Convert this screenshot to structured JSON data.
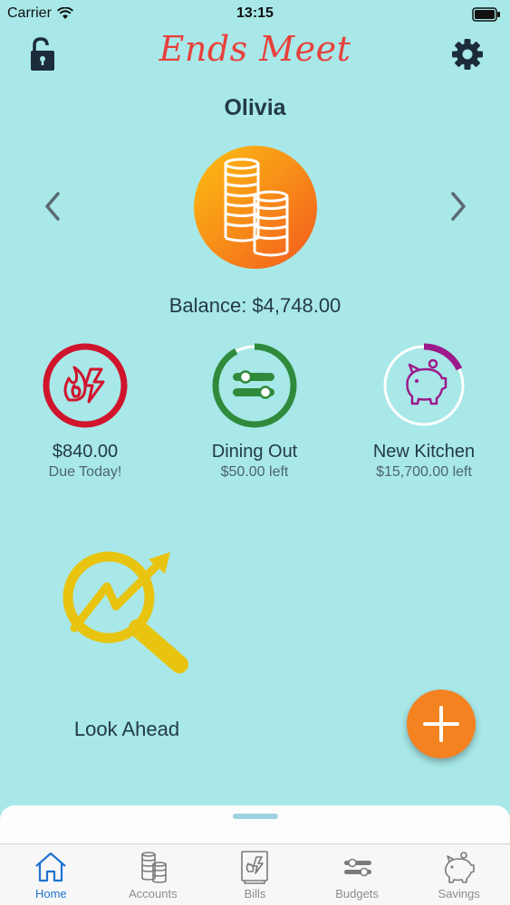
{
  "status": {
    "carrier": "Carrier",
    "time": "13:15"
  },
  "header": {
    "logo": "Ends Meet"
  },
  "account": {
    "name": "Olivia",
    "balance": "Balance: $4,748.00"
  },
  "tiles": [
    {
      "title": "$840.00",
      "subtitle": "Due Today!",
      "icon": "gas-electric-icon",
      "color": "#d0142c",
      "progress": 1.0
    },
    {
      "title": "Dining Out",
      "subtitle": "$50.00 left",
      "icon": "sliders-icon",
      "color": "#2f8a3c",
      "progress": 0.92
    },
    {
      "title": "New Kitchen",
      "subtitle": "$15,700.00 left",
      "icon": "piggy-bank-icon",
      "color": "#9c1a8c",
      "progress": 0.18
    }
  ],
  "look_ahead": {
    "label": "Look Ahead",
    "icon": "magnifier-trend-icon",
    "color": "#e8c410"
  },
  "tabs": [
    {
      "label": "Home",
      "icon": "home-icon",
      "active": true
    },
    {
      "label": "Accounts",
      "icon": "coins-icon",
      "active": false
    },
    {
      "label": "Bills",
      "icon": "bill-icon",
      "active": false
    },
    {
      "label": "Budgets",
      "icon": "sliders-icon",
      "active": false
    },
    {
      "label": "Savings",
      "icon": "piggy-bank-icon",
      "active": false
    }
  ]
}
